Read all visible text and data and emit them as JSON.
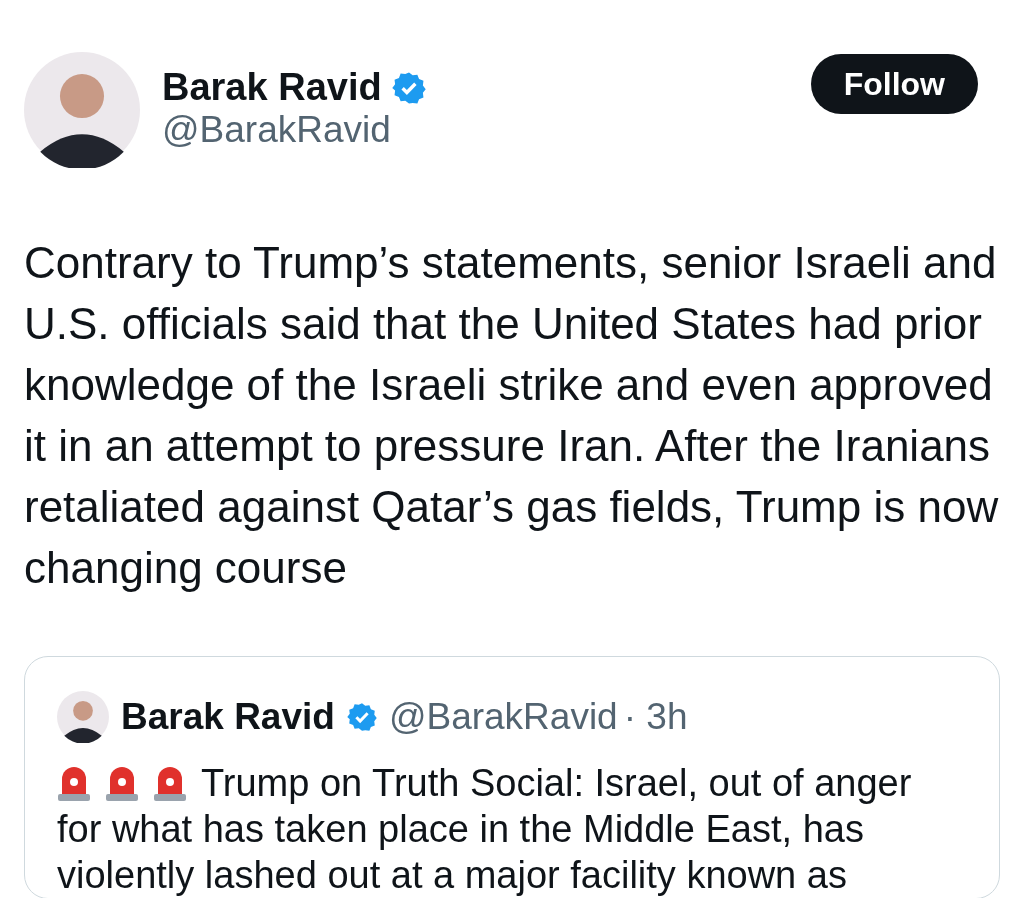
{
  "author": {
    "name": "Barak Ravid",
    "handle": "@BarakRavid",
    "verified": true
  },
  "follow_button": "Follow",
  "tweet_text": "Contrary to Trump’s statements, senior Israeli and U.S. officials said that the United States had prior knowledge of the Israeli strike and even approved it in an attempt to pressure Iran. After the Iranians retaliated against Qatar’s gas fields, Trump is now changing course",
  "quoted_tweet": {
    "name": "Barak Ravid",
    "verified": true,
    "handle": "@BarakRavid",
    "time": "· 3h",
    "sirens": [
      {
        "kind": "siren"
      },
      {
        "kind": "siren"
      },
      {
        "kind": "siren"
      }
    ],
    "text_lines": [
      "Trump on Truth Social: Israel, out of anger",
      "for what has taken place in the Middle East, has",
      "violently lashed out at a major facility known as"
    ]
  }
}
